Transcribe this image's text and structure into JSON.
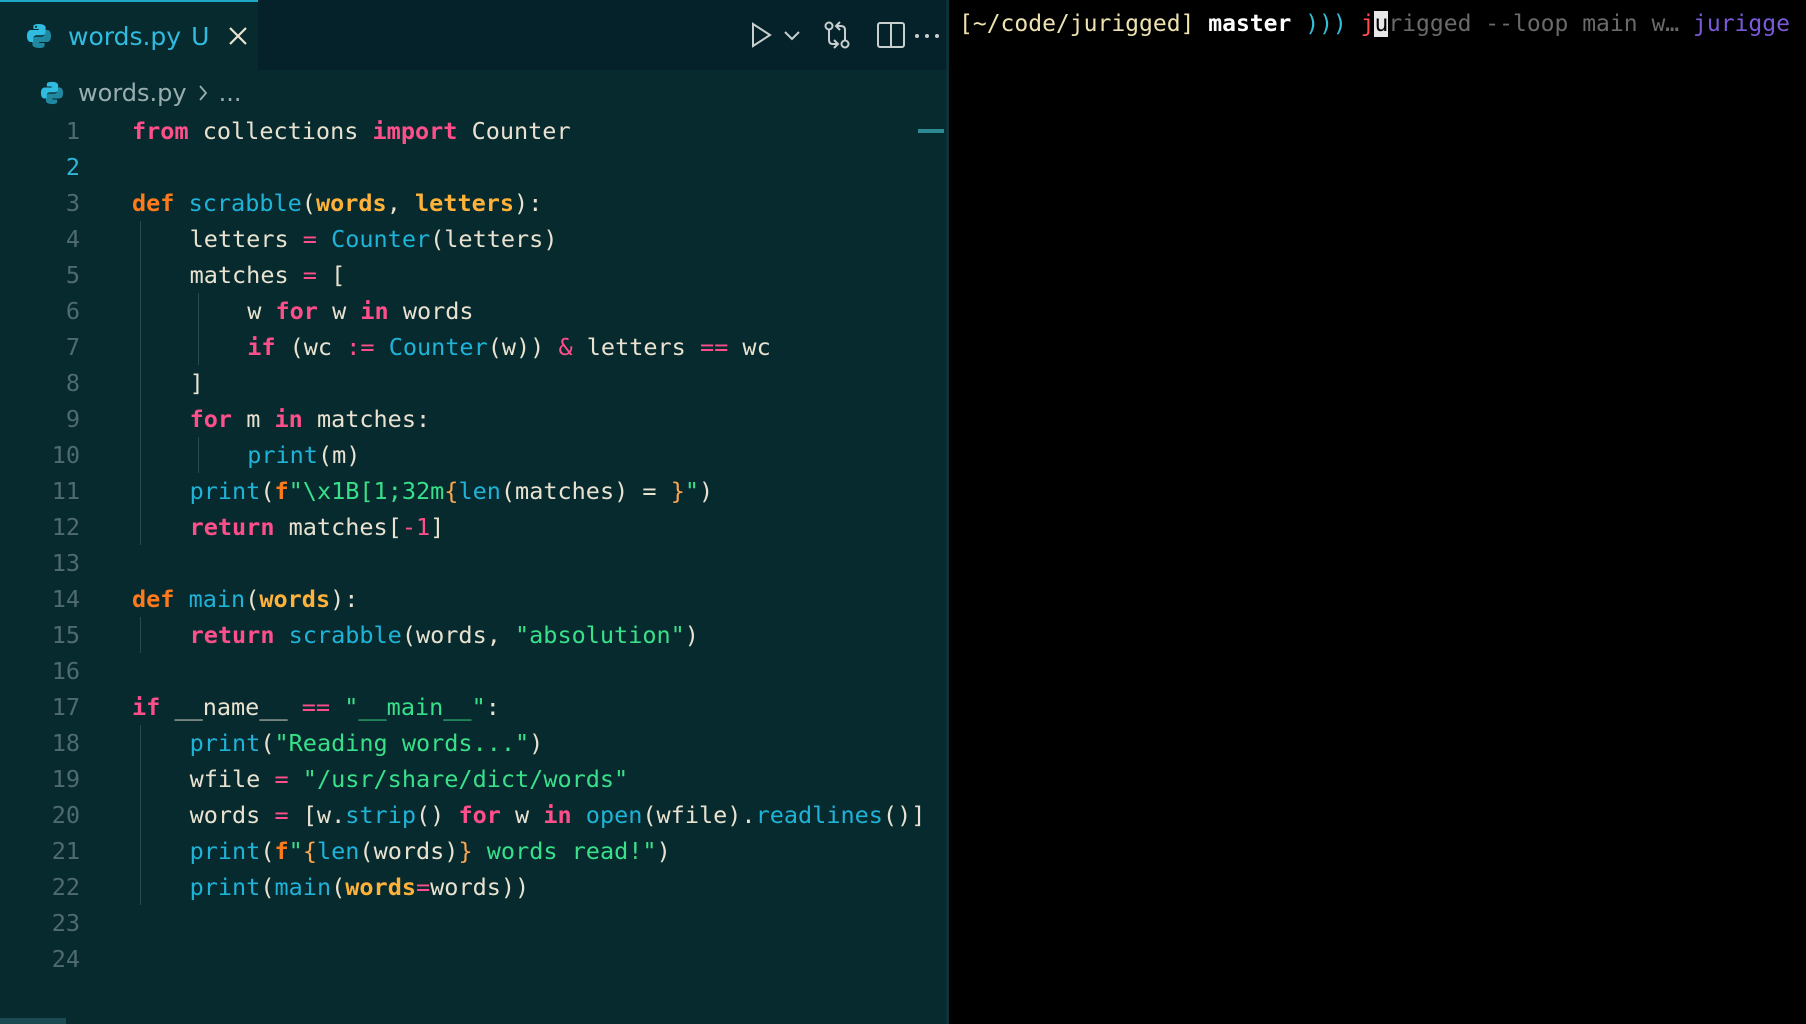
{
  "editor": {
    "tab": {
      "filename": "words.py",
      "status": "U"
    },
    "breadcrumb": {
      "file": "words.py",
      "symbol": "..."
    },
    "current_line": 2,
    "lines": [
      {
        "n": "1",
        "indent": 0,
        "tokens": [
          {
            "c": "k",
            "t": "from"
          },
          {
            "c": "b",
            "t": " collections "
          },
          {
            "c": "k",
            "t": "import"
          },
          {
            "c": "b",
            "t": " Counter"
          }
        ]
      },
      {
        "n": "2",
        "indent": 0,
        "tokens": []
      },
      {
        "n": "3",
        "indent": 0,
        "tokens": [
          {
            "c": "kd",
            "t": "def"
          },
          {
            "c": "b",
            "t": " "
          },
          {
            "c": "f",
            "t": "scrabble"
          },
          {
            "c": "b",
            "t": "("
          },
          {
            "c": "p",
            "t": "words"
          },
          {
            "c": "b",
            "t": ", "
          },
          {
            "c": "p",
            "t": "letters"
          },
          {
            "c": "b",
            "t": "):"
          }
        ]
      },
      {
        "n": "4",
        "indent": 1,
        "tokens": [
          {
            "c": "b",
            "t": "letters "
          },
          {
            "c": "n",
            "t": "="
          },
          {
            "c": "b",
            "t": " "
          },
          {
            "c": "f",
            "t": "Counter"
          },
          {
            "c": "b",
            "t": "(letters)"
          }
        ]
      },
      {
        "n": "5",
        "indent": 1,
        "tokens": [
          {
            "c": "b",
            "t": "matches "
          },
          {
            "c": "n",
            "t": "="
          },
          {
            "c": "b",
            "t": " ["
          }
        ]
      },
      {
        "n": "6",
        "indent": 2,
        "tokens": [
          {
            "c": "b",
            "t": "w "
          },
          {
            "c": "k",
            "t": "for"
          },
          {
            "c": "b",
            "t": " w "
          },
          {
            "c": "k",
            "t": "in"
          },
          {
            "c": "b",
            "t": " words"
          }
        ]
      },
      {
        "n": "7",
        "indent": 2,
        "tokens": [
          {
            "c": "k",
            "t": "if"
          },
          {
            "c": "b",
            "t": " (wc "
          },
          {
            "c": "n",
            "t": ":="
          },
          {
            "c": "b",
            "t": " "
          },
          {
            "c": "f",
            "t": "Counter"
          },
          {
            "c": "b",
            "t": "(w)) "
          },
          {
            "c": "n",
            "t": "&"
          },
          {
            "c": "b",
            "t": " letters "
          },
          {
            "c": "n",
            "t": "=="
          },
          {
            "c": "b",
            "t": " wc"
          }
        ]
      },
      {
        "n": "8",
        "indent": 1,
        "tokens": [
          {
            "c": "b",
            "t": "]"
          }
        ]
      },
      {
        "n": "9",
        "indent": 1,
        "tokens": [
          {
            "c": "k",
            "t": "for"
          },
          {
            "c": "b",
            "t": " m "
          },
          {
            "c": "k",
            "t": "in"
          },
          {
            "c": "b",
            "t": " matches:"
          }
        ]
      },
      {
        "n": "10",
        "indent": 2,
        "tokens": [
          {
            "c": "f",
            "t": "print"
          },
          {
            "c": "b",
            "t": "(m)"
          }
        ]
      },
      {
        "n": "11",
        "indent": 1,
        "tokens": [
          {
            "c": "f",
            "t": "print"
          },
          {
            "c": "b",
            "t": "("
          },
          {
            "c": "kd",
            "t": "f"
          },
          {
            "c": "s",
            "t": "\"\\x1B[1;32m"
          },
          {
            "c": "d",
            "t": "{"
          },
          {
            "c": "f",
            "t": "len"
          },
          {
            "c": "b",
            "t": "(matches) = "
          },
          {
            "c": "d",
            "t": "}"
          },
          {
            "c": "s",
            "t": "\""
          },
          {
            "c": "b",
            "t": ")"
          }
        ]
      },
      {
        "n": "12",
        "indent": 1,
        "tokens": [
          {
            "c": "k",
            "t": "return"
          },
          {
            "c": "b",
            "t": " matches["
          },
          {
            "c": "n",
            "t": "-1"
          },
          {
            "c": "b",
            "t": "]"
          }
        ]
      },
      {
        "n": "13",
        "indent": 0,
        "tokens": []
      },
      {
        "n": "14",
        "indent": 0,
        "tokens": [
          {
            "c": "kd",
            "t": "def"
          },
          {
            "c": "b",
            "t": " "
          },
          {
            "c": "f",
            "t": "main"
          },
          {
            "c": "b",
            "t": "("
          },
          {
            "c": "p",
            "t": "words"
          },
          {
            "c": "b",
            "t": "):"
          }
        ]
      },
      {
        "n": "15",
        "indent": 1,
        "tokens": [
          {
            "c": "k",
            "t": "return"
          },
          {
            "c": "b",
            "t": " "
          },
          {
            "c": "f",
            "t": "scrabble"
          },
          {
            "c": "b",
            "t": "(words, "
          },
          {
            "c": "s",
            "t": "\"absolution\""
          },
          {
            "c": "b",
            "t": ")"
          }
        ]
      },
      {
        "n": "16",
        "indent": 0,
        "tokens": []
      },
      {
        "n": "17",
        "indent": 0,
        "tokens": [
          {
            "c": "k",
            "t": "if"
          },
          {
            "c": "b",
            "t": " __name__ "
          },
          {
            "c": "n",
            "t": "=="
          },
          {
            "c": "b",
            "t": " "
          },
          {
            "c": "s",
            "t": "\"__main__\""
          },
          {
            "c": "b",
            "t": ":"
          }
        ]
      },
      {
        "n": "18",
        "indent": 1,
        "tokens": [
          {
            "c": "f",
            "t": "print"
          },
          {
            "c": "b",
            "t": "("
          },
          {
            "c": "s",
            "t": "\"Reading words...\""
          },
          {
            "c": "b",
            "t": ")"
          }
        ]
      },
      {
        "n": "19",
        "indent": 1,
        "tokens": [
          {
            "c": "b",
            "t": "wfile "
          },
          {
            "c": "n",
            "t": "="
          },
          {
            "c": "b",
            "t": " "
          },
          {
            "c": "s",
            "t": "\"/usr/share/dict/words\""
          }
        ]
      },
      {
        "n": "20",
        "indent": 1,
        "tokens": [
          {
            "c": "b",
            "t": "words "
          },
          {
            "c": "n",
            "t": "="
          },
          {
            "c": "b",
            "t": " [w."
          },
          {
            "c": "f",
            "t": "strip"
          },
          {
            "c": "b",
            "t": "() "
          },
          {
            "c": "k",
            "t": "for"
          },
          {
            "c": "b",
            "t": " w "
          },
          {
            "c": "k",
            "t": "in"
          },
          {
            "c": "b",
            "t": " "
          },
          {
            "c": "f",
            "t": "open"
          },
          {
            "c": "b",
            "t": "(wfile)."
          },
          {
            "c": "f",
            "t": "readlines"
          },
          {
            "c": "b",
            "t": "()]"
          }
        ]
      },
      {
        "n": "21",
        "indent": 1,
        "tokens": [
          {
            "c": "f",
            "t": "print"
          },
          {
            "c": "b",
            "t": "("
          },
          {
            "c": "kd",
            "t": "f"
          },
          {
            "c": "s",
            "t": "\""
          },
          {
            "c": "d",
            "t": "{"
          },
          {
            "c": "f",
            "t": "len"
          },
          {
            "c": "b",
            "t": "(words)"
          },
          {
            "c": "d",
            "t": "}"
          },
          {
            "c": "s",
            "t": " words read!\""
          },
          {
            "c": "b",
            "t": ")"
          }
        ]
      },
      {
        "n": "22",
        "indent": 1,
        "tokens": [
          {
            "c": "f",
            "t": "print"
          },
          {
            "c": "b",
            "t": "("
          },
          {
            "c": "f",
            "t": "main"
          },
          {
            "c": "b",
            "t": "("
          },
          {
            "c": "p",
            "t": "words"
          },
          {
            "c": "n",
            "t": "="
          },
          {
            "c": "b",
            "t": "words))"
          }
        ]
      },
      {
        "n": "23",
        "indent": 0,
        "tokens": []
      },
      {
        "n": "24",
        "indent": 0,
        "tokens": []
      }
    ]
  },
  "terminal": {
    "path": "[~/code/jurigged]",
    "branch": "master",
    "prompt": ")))",
    "typed": "j",
    "cursor_char": "u",
    "suggestion": "rigged --loop main w…",
    "right_text": "jurigge"
  },
  "icons": {
    "tab_file": "python-file-icon",
    "close": "close-icon",
    "run": "play-icon",
    "run_menu": "chevron-down-icon",
    "compare": "git-compare-icon",
    "split": "split-editor-icon",
    "more": "ellipsis-icon"
  },
  "colors": {
    "editor_bg": "#072a2e",
    "terminal_bg": "#000000",
    "accent": "#30bce0",
    "keyword": "#ff4f8b",
    "def": "#ff7a1a",
    "function": "#1fb3d8",
    "string": "#39e08a"
  }
}
